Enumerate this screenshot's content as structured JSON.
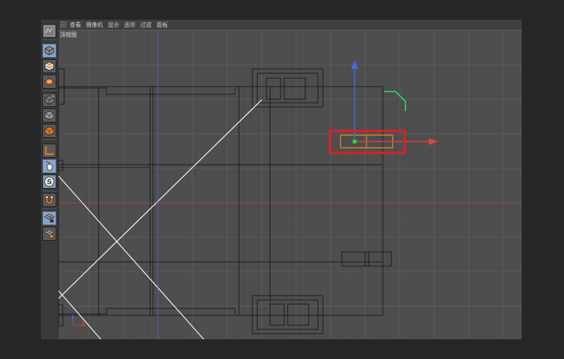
{
  "menu": {
    "items": [
      "查看",
      "摄像机",
      "显示",
      "选项",
      "过滤",
      "面板"
    ]
  },
  "viewport": {
    "label": "顶视图"
  },
  "toolbar": {
    "tools": [
      {
        "name": "viewport-thumbnail-icon"
      },
      {
        "name": "cube-icon"
      },
      {
        "name": "checker-cube-icon"
      },
      {
        "name": "checker-plane-icon"
      },
      {
        "name": "wire-cube-icon"
      },
      {
        "name": "solid-cube-icon"
      },
      {
        "name": "orange-cube-icon"
      },
      {
        "name": "axis-icon"
      },
      {
        "name": "mouse-icon"
      },
      {
        "name": "snap-s-icon"
      },
      {
        "name": "magnet-icon"
      },
      {
        "name": "locked-grid-icon"
      },
      {
        "name": "grid-sphere-icon"
      }
    ]
  },
  "colors": {
    "grid_major": "#5c5c5c",
    "grid_minor": "#545454",
    "x_axis": "#d83a3a",
    "y_axis": "#4468e0",
    "selection_outline": "#ff8c1a",
    "highlight_box": "#e31e24",
    "pivot": "#3cd03c",
    "wire": "#1a1a1a"
  }
}
